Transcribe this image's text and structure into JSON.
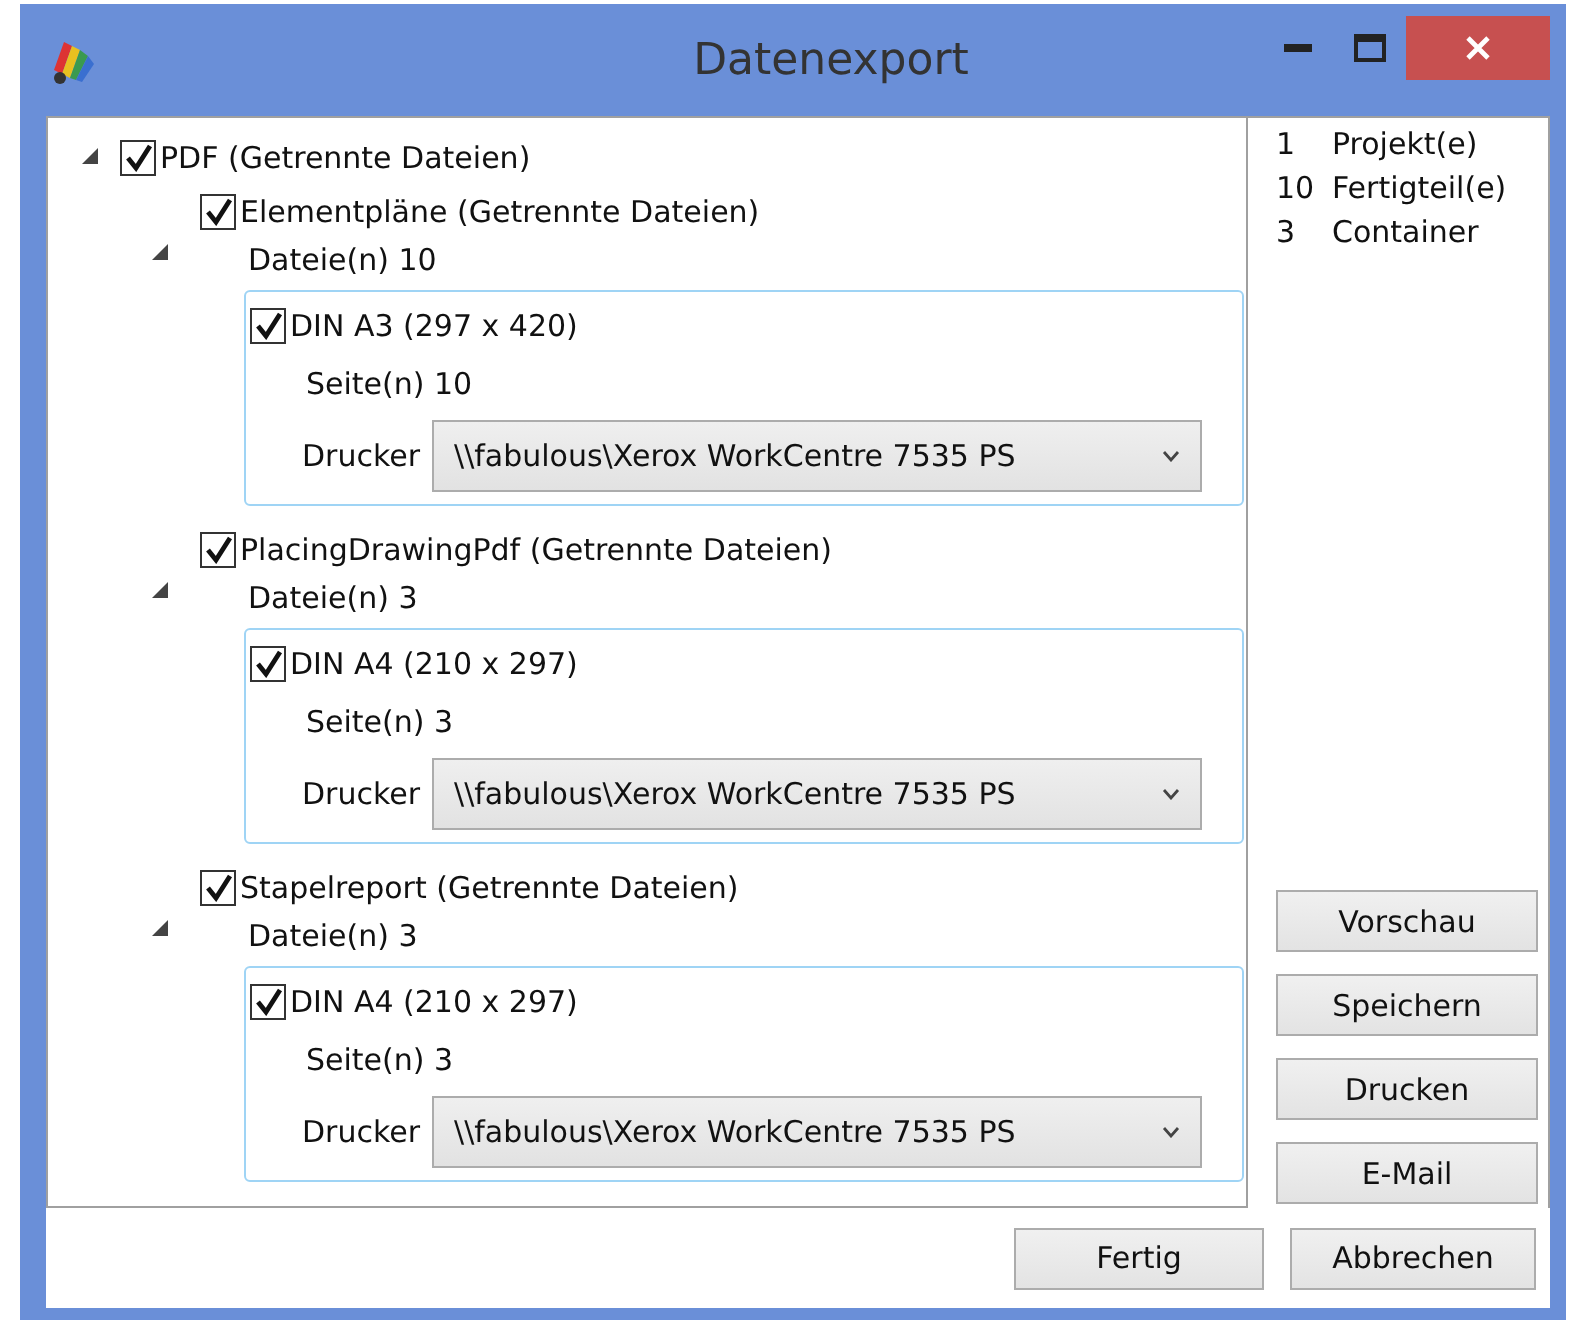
{
  "window": {
    "title": "Datenexport"
  },
  "tree": {
    "label": "PDF",
    "note": "(Getrennte Dateien)",
    "checked": true,
    "expanded": true,
    "children": [
      {
        "label": "Elementpläne",
        "note": "(Getrennte Dateien)",
        "checked": true,
        "expanded": true,
        "files": "Dateie(n) 10",
        "formats": [
          {
            "label": "DIN A3 (297 x 420)",
            "checked": true,
            "pages": "Seite(n) 10",
            "printer_label": "Drucker",
            "printer": "\\\\fabulous\\Xerox WorkCentre 7535 PS"
          }
        ]
      },
      {
        "label": "PlacingDrawingPdf",
        "note": "(Getrennte Dateien)",
        "checked": true,
        "expanded": true,
        "files": "Dateie(n) 3",
        "formats": [
          {
            "label": "DIN A4 (210 x 297)",
            "checked": true,
            "pages": "Seite(n) 3",
            "printer_label": "Drucker",
            "printer": "\\\\fabulous\\Xerox WorkCentre 7535 PS"
          }
        ]
      },
      {
        "label": "Stapelreport",
        "note": "(Getrennte Dateien)",
        "checked": true,
        "expanded": true,
        "files": "Dateie(n) 3",
        "formats": [
          {
            "label": "DIN A4 (210 x 297)",
            "checked": true,
            "pages": "Seite(n) 3",
            "printer_label": "Drucker",
            "printer": "\\\\fabulous\\Xerox WorkCentre 7535 PS"
          }
        ]
      }
    ]
  },
  "summary": [
    {
      "count": "1",
      "label": "Projekt(e)"
    },
    {
      "count": "10",
      "label": "Fertigteil(e)"
    },
    {
      "count": "3",
      "label": "Container"
    }
  ],
  "side_buttons": [
    "Vorschau",
    "Speichern",
    "Drucken",
    "E-Mail"
  ],
  "footer_buttons": [
    "Fertig",
    "Abbrechen"
  ]
}
